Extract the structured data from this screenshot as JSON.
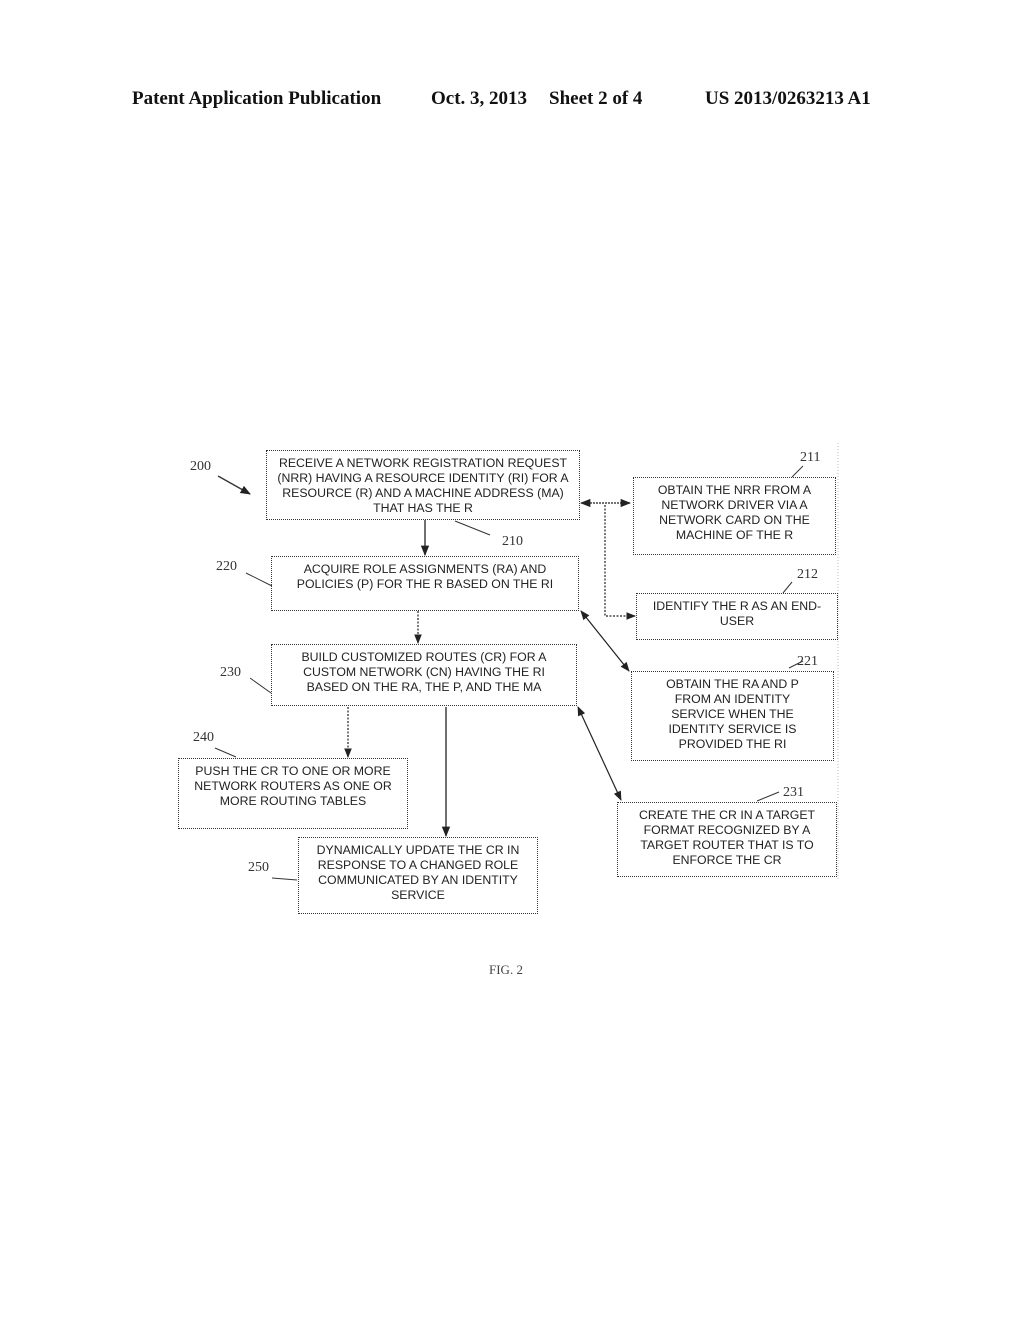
{
  "header": {
    "publication": "Patent Application Publication",
    "date": "Oct. 3, 2013",
    "sheet": "Sheet 2 of 4",
    "number": "US 2013/0263213 A1"
  },
  "figure": {
    "label": "FIG. 2",
    "method_ref": "200",
    "steps": [
      {
        "ref": "210",
        "text": "RECEIVE A NETWORK REGISTRATION REQUEST (NRR) HAVING A RESOURCE IDENTITY (RI) FOR A RESOURCE (R) AND A MACHINE ADDRESS (MA) THAT HAS THE R"
      },
      {
        "ref": "211",
        "text": "OBTAIN THE NRR FROM A NETWORK DRIVER VIA A NETWORK CARD ON THE MACHINE OF THE R"
      },
      {
        "ref": "212",
        "text": "IDENTIFY THE R AS AN END-USER"
      },
      {
        "ref": "220",
        "text": "ACQUIRE ROLE ASSIGNMENTS (RA) AND POLICIES (P) FOR THE R BASED ON THE RI"
      },
      {
        "ref": "221",
        "text": "OBTAIN THE RA AND P FROM AN IDENTITY SERVICE WHEN THE IDENTITY SERVICE IS PROVIDED THE RI"
      },
      {
        "ref": "230",
        "text": "BUILD CUSTOMIZED ROUTES (CR) FOR A CUSTOM NETWORK (CN) HAVING THE RI BASED ON THE RA, THE P, AND THE MA"
      },
      {
        "ref": "231",
        "text": "CREATE THE CR IN A TARGET FORMAT RECOGNIZED BY A TARGET ROUTER THAT IS TO ENFORCE THE CR"
      },
      {
        "ref": "240",
        "text": "PUSH THE CR TO ONE OR MORE NETWORK ROUTERS AS ONE OR MORE ROUTING TABLES"
      },
      {
        "ref": "250",
        "text": "DYNAMICALLY UPDATE THE CR IN RESPONSE TO A CHANGED ROLE COMMUNICATED BY AN IDENTITY SERVICE"
      }
    ]
  }
}
